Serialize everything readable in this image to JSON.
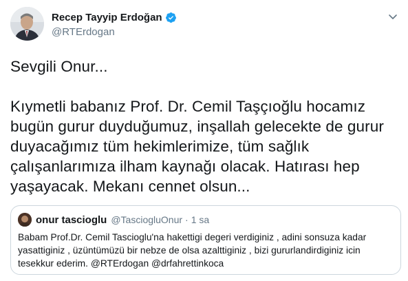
{
  "author": {
    "display_name": "Recep Tayyip Erdoğan",
    "handle": "@RTErdogan",
    "verified_icon": "verified-badge-icon",
    "avatar_icon": "avatar"
  },
  "menu": {
    "caret_icon": "chevron-down-icon"
  },
  "tweet": {
    "greeting": "Sevgili Onur...",
    "lines": [
      "Kıymetli babanız Prof. Dr. Cemil Taşçıoğlu hocamız",
      "bugün gurur duyduğumuz, inşallah gelecekte de gurur",
      "duyacağımız tüm hekimlerimize, tüm sağlık",
      "çalışanlarımıza ilham kaynağı olacak. Hatırası hep",
      "yaşayacak. Mekanı cennet olsun..."
    ]
  },
  "quoted_tweet": {
    "display_name": "onur tascioglu",
    "handle": "@TasciogluOnur",
    "separator": "·",
    "time": "1 sa",
    "lines": [
      "Babam Prof.Dr. Cemil Tascioglu'na hakettigi degeri verdiginiz , adini sonsuza kadar",
      "yasattiginiz , üzüntümüzü bir nebze de olsa azalttiginiz , bizi gururlandirdiginiz icin",
      "tesekkur ederim. @RTErdogan @drfahrettinkoca"
    ]
  },
  "colors": {
    "text_primary": "#14171a",
    "text_secondary": "#657786",
    "verified_blue": "#1da1f2",
    "border": "#ccd6dd"
  }
}
